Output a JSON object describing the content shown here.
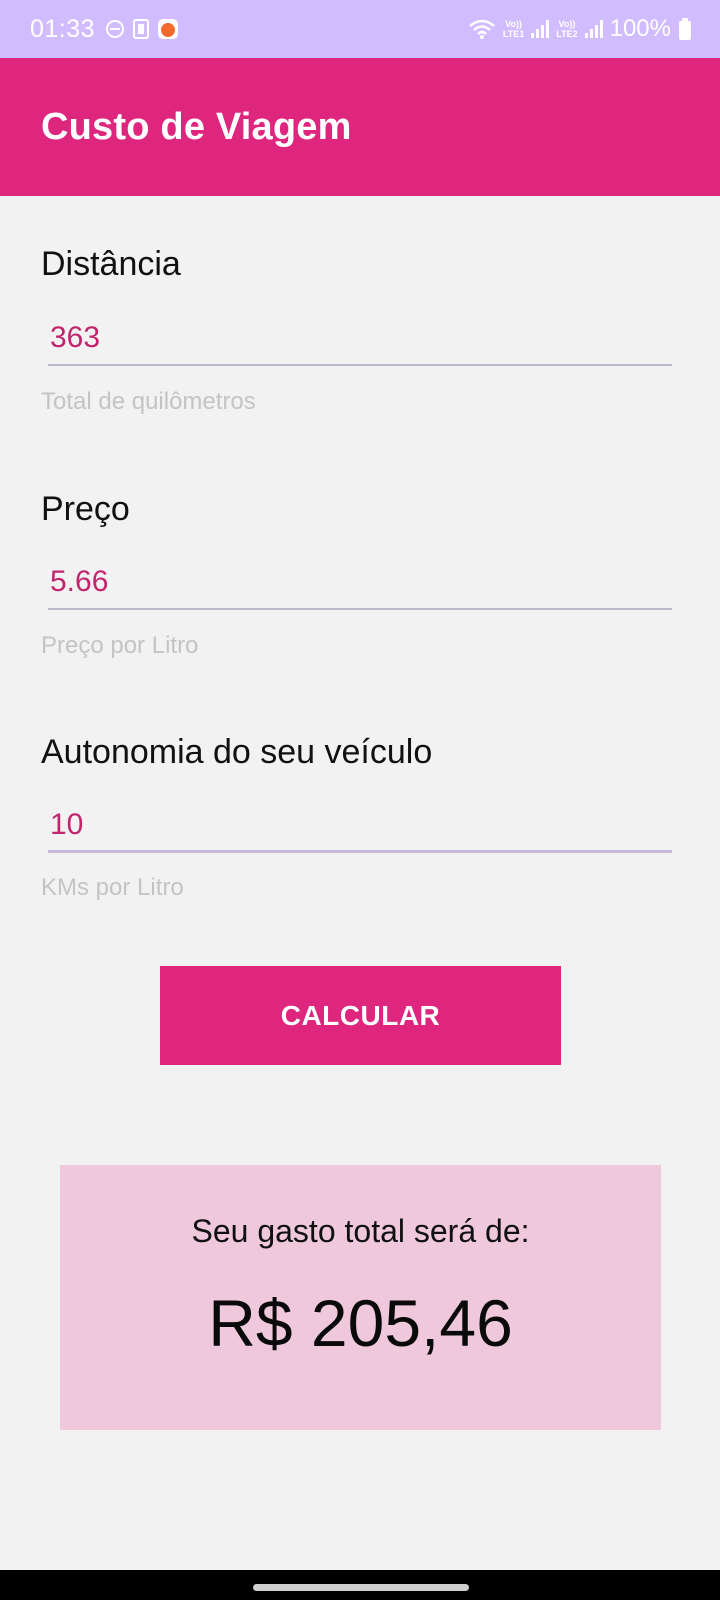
{
  "status_bar": {
    "time": "01:33",
    "battery": "100%",
    "icons": [
      "do-not-disturb-icon",
      "device-icon",
      "app-notification-icon",
      "wifi-icon",
      "signal-lte1-icon",
      "signal-lte2-icon",
      "battery-icon"
    ],
    "lte1": "LTE1",
    "lte2": "LTE2",
    "volte": "Vo))"
  },
  "app_bar": {
    "title": "Custo de Viagem"
  },
  "form": {
    "distance": {
      "label": "Distância",
      "value": "363",
      "helper": "Total de quilômetros"
    },
    "price": {
      "label": "Preço",
      "value": "5.66",
      "helper": "Preço por Litro"
    },
    "autonomy": {
      "label": "Autonomia do seu veículo",
      "value": "10",
      "helper": "KMs por Litro"
    }
  },
  "calculate_button": {
    "label": "CALCULAR"
  },
  "result": {
    "label": "Seu gasto total será de:",
    "value": "R$ 205,46"
  },
  "colors": {
    "accent": "#de267e",
    "status_bar": "#d0bcff",
    "input_text": "#c2246e",
    "result_background": "#efc8dc",
    "background": "#f2f2f2"
  }
}
